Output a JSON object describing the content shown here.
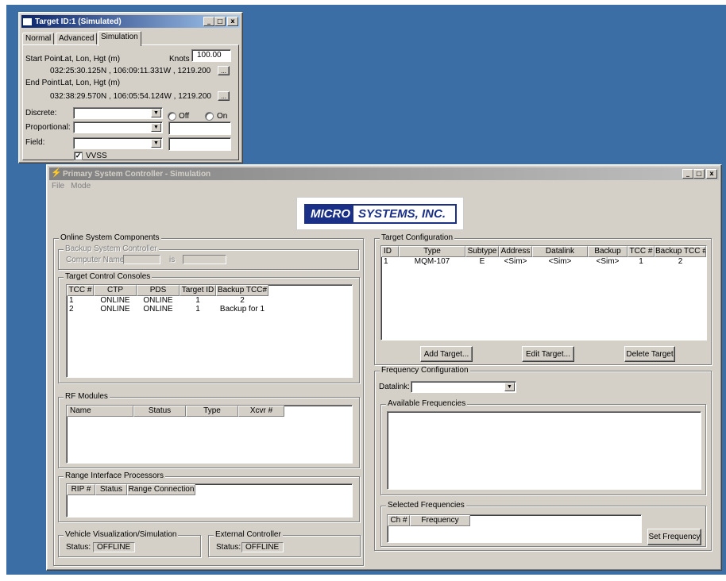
{
  "target_window": {
    "title": "Target ID:1 (Simulated)",
    "tabs": [
      "Normal",
      "Advanced",
      "Simulation"
    ],
    "active_tab": "Simulation",
    "start_point_label": "Start Point",
    "start_point_units": "Lat, Lon, Hgt (m)",
    "knots_label": "Knots",
    "knots_value": "100.00",
    "start_point_value": "032:25:30.125N , 106:09:11.331W , 1219.200",
    "end_point_label": "End Point",
    "end_point_units": "Lat, Lon, Hgt (m)",
    "end_point_value": "032:38:29.570N , 106:05:54.124W , 1219.200",
    "browse_label": "...",
    "discrete_label": "Discrete:",
    "off_label": "Off",
    "on_label": "On",
    "proportional_label": "Proportional:",
    "field_label": "Field:",
    "vvss_label": "VVSS",
    "vvss_checked": true,
    "minimize": "_",
    "maximize": "□",
    "close": "x"
  },
  "main_window": {
    "title": "Primary System Controller - Simulation",
    "menu": [
      "File",
      "Mode"
    ],
    "logo_left": "MICRO",
    "logo_right": "SYSTEMS, INC.",
    "online_components": {
      "label": "Online System Components",
      "backup_label": "Backup System Controller",
      "computer_name_label": "Computer Name:",
      "is_label": "is"
    },
    "tcc": {
      "label": "Target Control Consoles",
      "columns": [
        "TCC #",
        "CTP",
        "PDS",
        "Target ID",
        "Backup TCC#"
      ],
      "rows": [
        [
          "1",
          "ONLINE",
          "ONLINE",
          "1",
          "2"
        ],
        [
          "2",
          "ONLINE",
          "ONLINE",
          "1",
          "Backup for 1"
        ]
      ]
    },
    "rf": {
      "label": "RF Modules",
      "columns": [
        "Name",
        "Status",
        "Type",
        "Xcvr #"
      ]
    },
    "rip": {
      "label": "Range Interface Processors",
      "columns": [
        "RIP #",
        "Status",
        "Range Connection"
      ]
    },
    "vehicle": {
      "label": "Vehicle Visualization/Simulation",
      "status_label": "Status:",
      "status_value": "OFFLINE"
    },
    "external": {
      "label": "External Controller",
      "status_label": "Status:",
      "status_value": "OFFLINE"
    },
    "target_config": {
      "label": "Target Configuration",
      "columns": [
        "ID",
        "Type",
        "Subtype",
        "Address",
        "Datalink",
        "Backup",
        "TCC #",
        "Backup TCC #"
      ],
      "rows": [
        [
          "1",
          "MQM-107",
          "E",
          "<Sim>",
          "<Sim>",
          "<Sim>",
          "1",
          "2"
        ]
      ],
      "add_button": "Add Target...",
      "edit_button": "Edit Target...",
      "delete_button": "Delete Target"
    },
    "freq_config": {
      "label": "Frequency Configuration",
      "datalink_label": "Datalink:",
      "available_label": "Available Frequencies",
      "selected_label": "Selected Frequencies",
      "selected_columns": [
        "Ch #",
        "Frequency"
      ],
      "set_button": "Set Frequency"
    }
  }
}
